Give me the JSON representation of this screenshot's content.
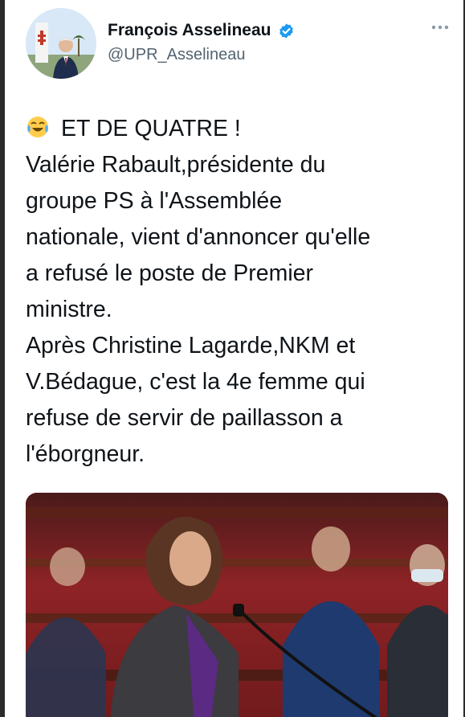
{
  "tweet": {
    "author": {
      "display_name": "François Asselineau",
      "handle": "@UPR_Asselineau",
      "verified": true
    },
    "more_icon": "more-dots-icon",
    "emoji": "tears-of-joy-emoji",
    "lines": [
      "ET DE QUATRE !",
      "Valérie Rabault,présidente du",
      "groupe PS à l'Assemblée",
      "nationale, vient d'annoncer qu'elle",
      "a refusé le poste de Premier",
      "ministre.",
      "Après Christine Lagarde,NKM et",
      "V.Bédague, c'est la 4e femme qui",
      "refuse de servir de paillasson a",
      "l'éborgneur."
    ]
  },
  "colors": {
    "verified_blue": "#1d9bf0",
    "text": "#0f1419",
    "secondary": "#536471"
  }
}
